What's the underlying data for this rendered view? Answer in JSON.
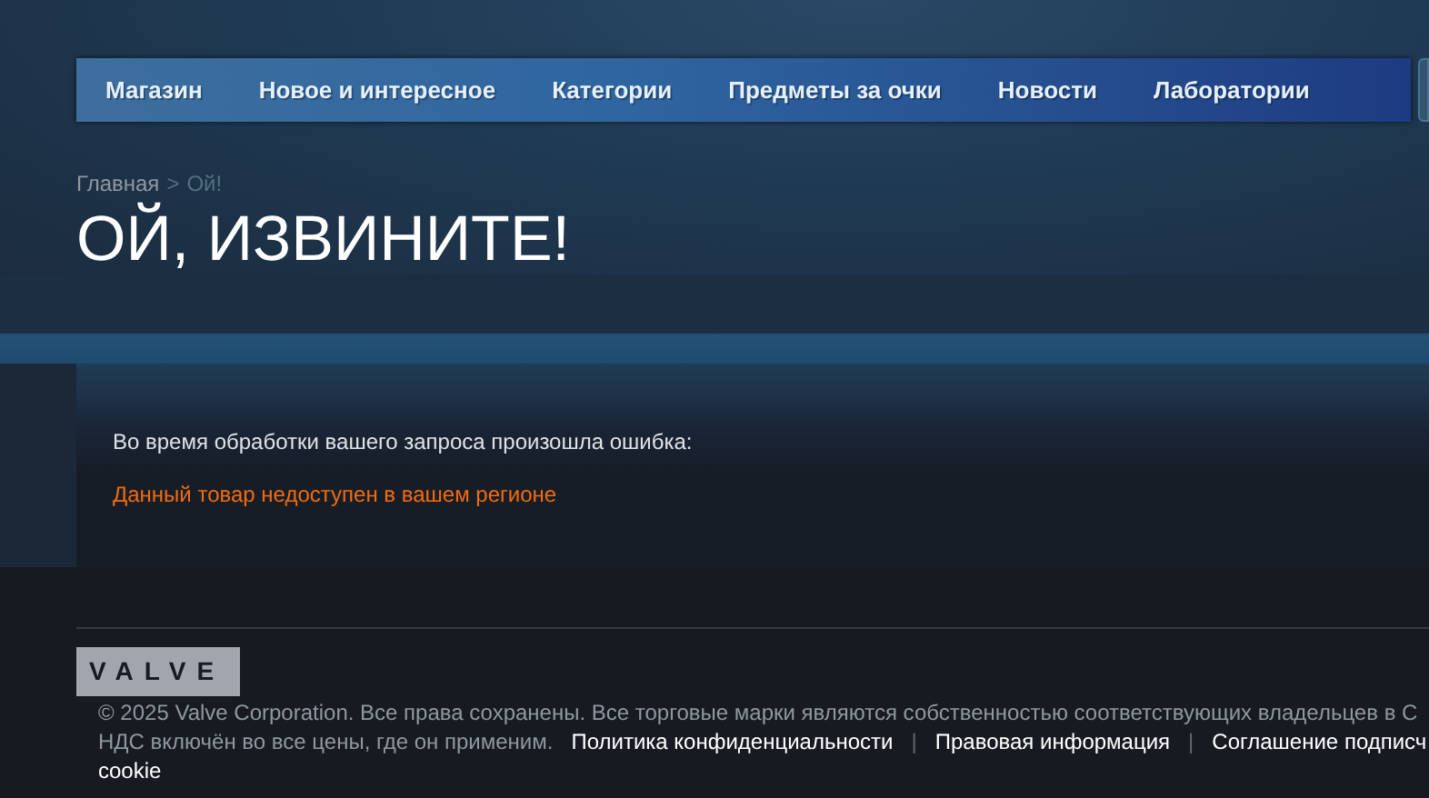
{
  "nav": {
    "items": [
      {
        "label": "Магазин"
      },
      {
        "label": "Новое и интересное"
      },
      {
        "label": "Категории"
      },
      {
        "label": "Предметы за очки"
      },
      {
        "label": "Новости"
      },
      {
        "label": "Лаборатории"
      }
    ]
  },
  "breadcrumb": {
    "items": [
      "Главная",
      "Ой!"
    ],
    "separator": ">"
  },
  "title": "ОЙ, ИЗВИНИТЕ!",
  "error": {
    "message": "Во время обработки вашего запроса произошла ошибка:",
    "detail": "Данный товар недоступен в вашем регионе"
  },
  "footer": {
    "logo": "VALVE",
    "copyright": "© 2025 Valve Corporation. Все права сохранены. Все торговые марки являются собственностью соответствующих владельцев в С",
    "vat": "НДС включён во все цены, где он применим.",
    "links": [
      "Политика конфиденциальности",
      "Правовая информация",
      "Соглашение подписч"
    ],
    "separator": "|",
    "last_line": "cookie"
  }
}
